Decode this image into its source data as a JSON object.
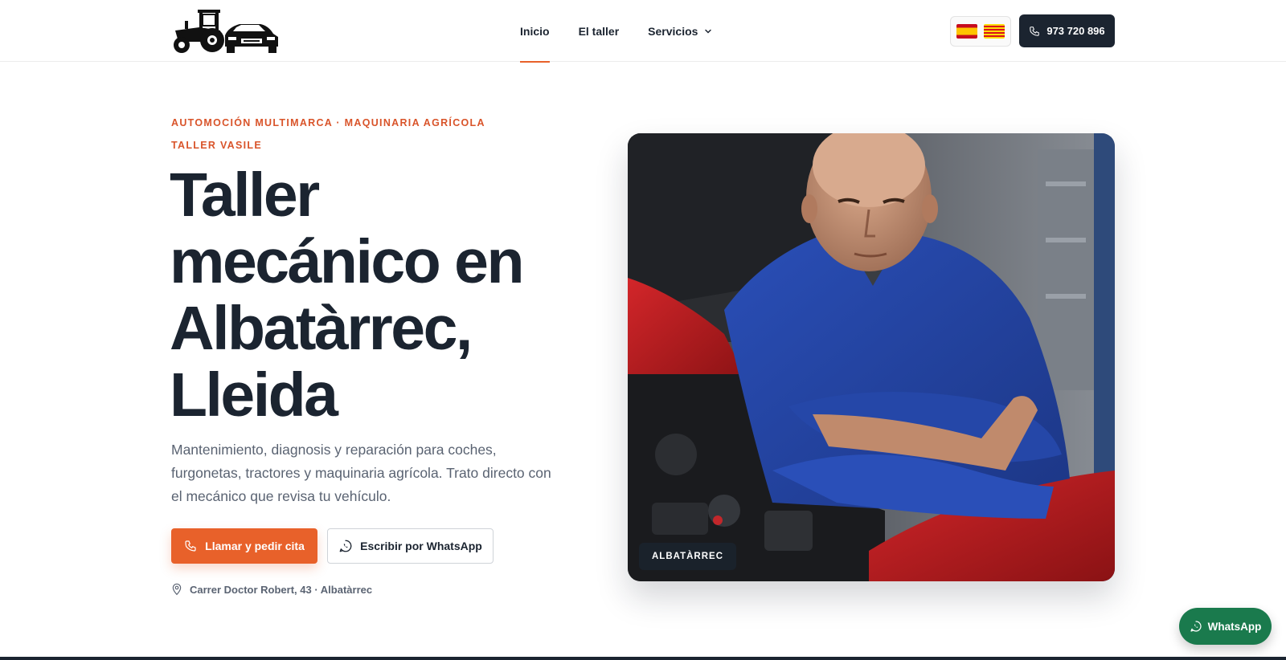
{
  "header": {
    "nav": [
      {
        "label": "Inicio",
        "active": true
      },
      {
        "label": "El taller",
        "active": false
      },
      {
        "label": "Servicios",
        "active": false
      }
    ],
    "languages": [
      "es-flag-icon",
      "ca-flag-icon"
    ],
    "phone": "973 720 896"
  },
  "hero": {
    "eyebrow_line1": "AUTOMOCIÓN MULTIMARCA · MAQUINARIA AGRÍCOLA",
    "eyebrow_line2": "TALLER VASILE",
    "title": "Taller mecánico en Albatàrrec, Lleida",
    "description": "Mantenimiento, diagnosis y reparación para coches, furgonetas, tractores y maquinaria agrícola. Trato directo con el mecánico que revisa tu vehículo.",
    "primary_cta": "Llamar y pedir cita",
    "secondary_cta": "Escribir por WhatsApp",
    "address": "Carrer Doctor Robert, 43 · Albatàrrec",
    "image_badge": "ALBATÀRREC"
  },
  "floating": {
    "whatsapp_label": "WhatsApp"
  },
  "colors": {
    "accent": "#e8612a",
    "dark": "#1b2430",
    "whatsapp": "#1a7a4d",
    "muted_text": "#5a6372"
  }
}
